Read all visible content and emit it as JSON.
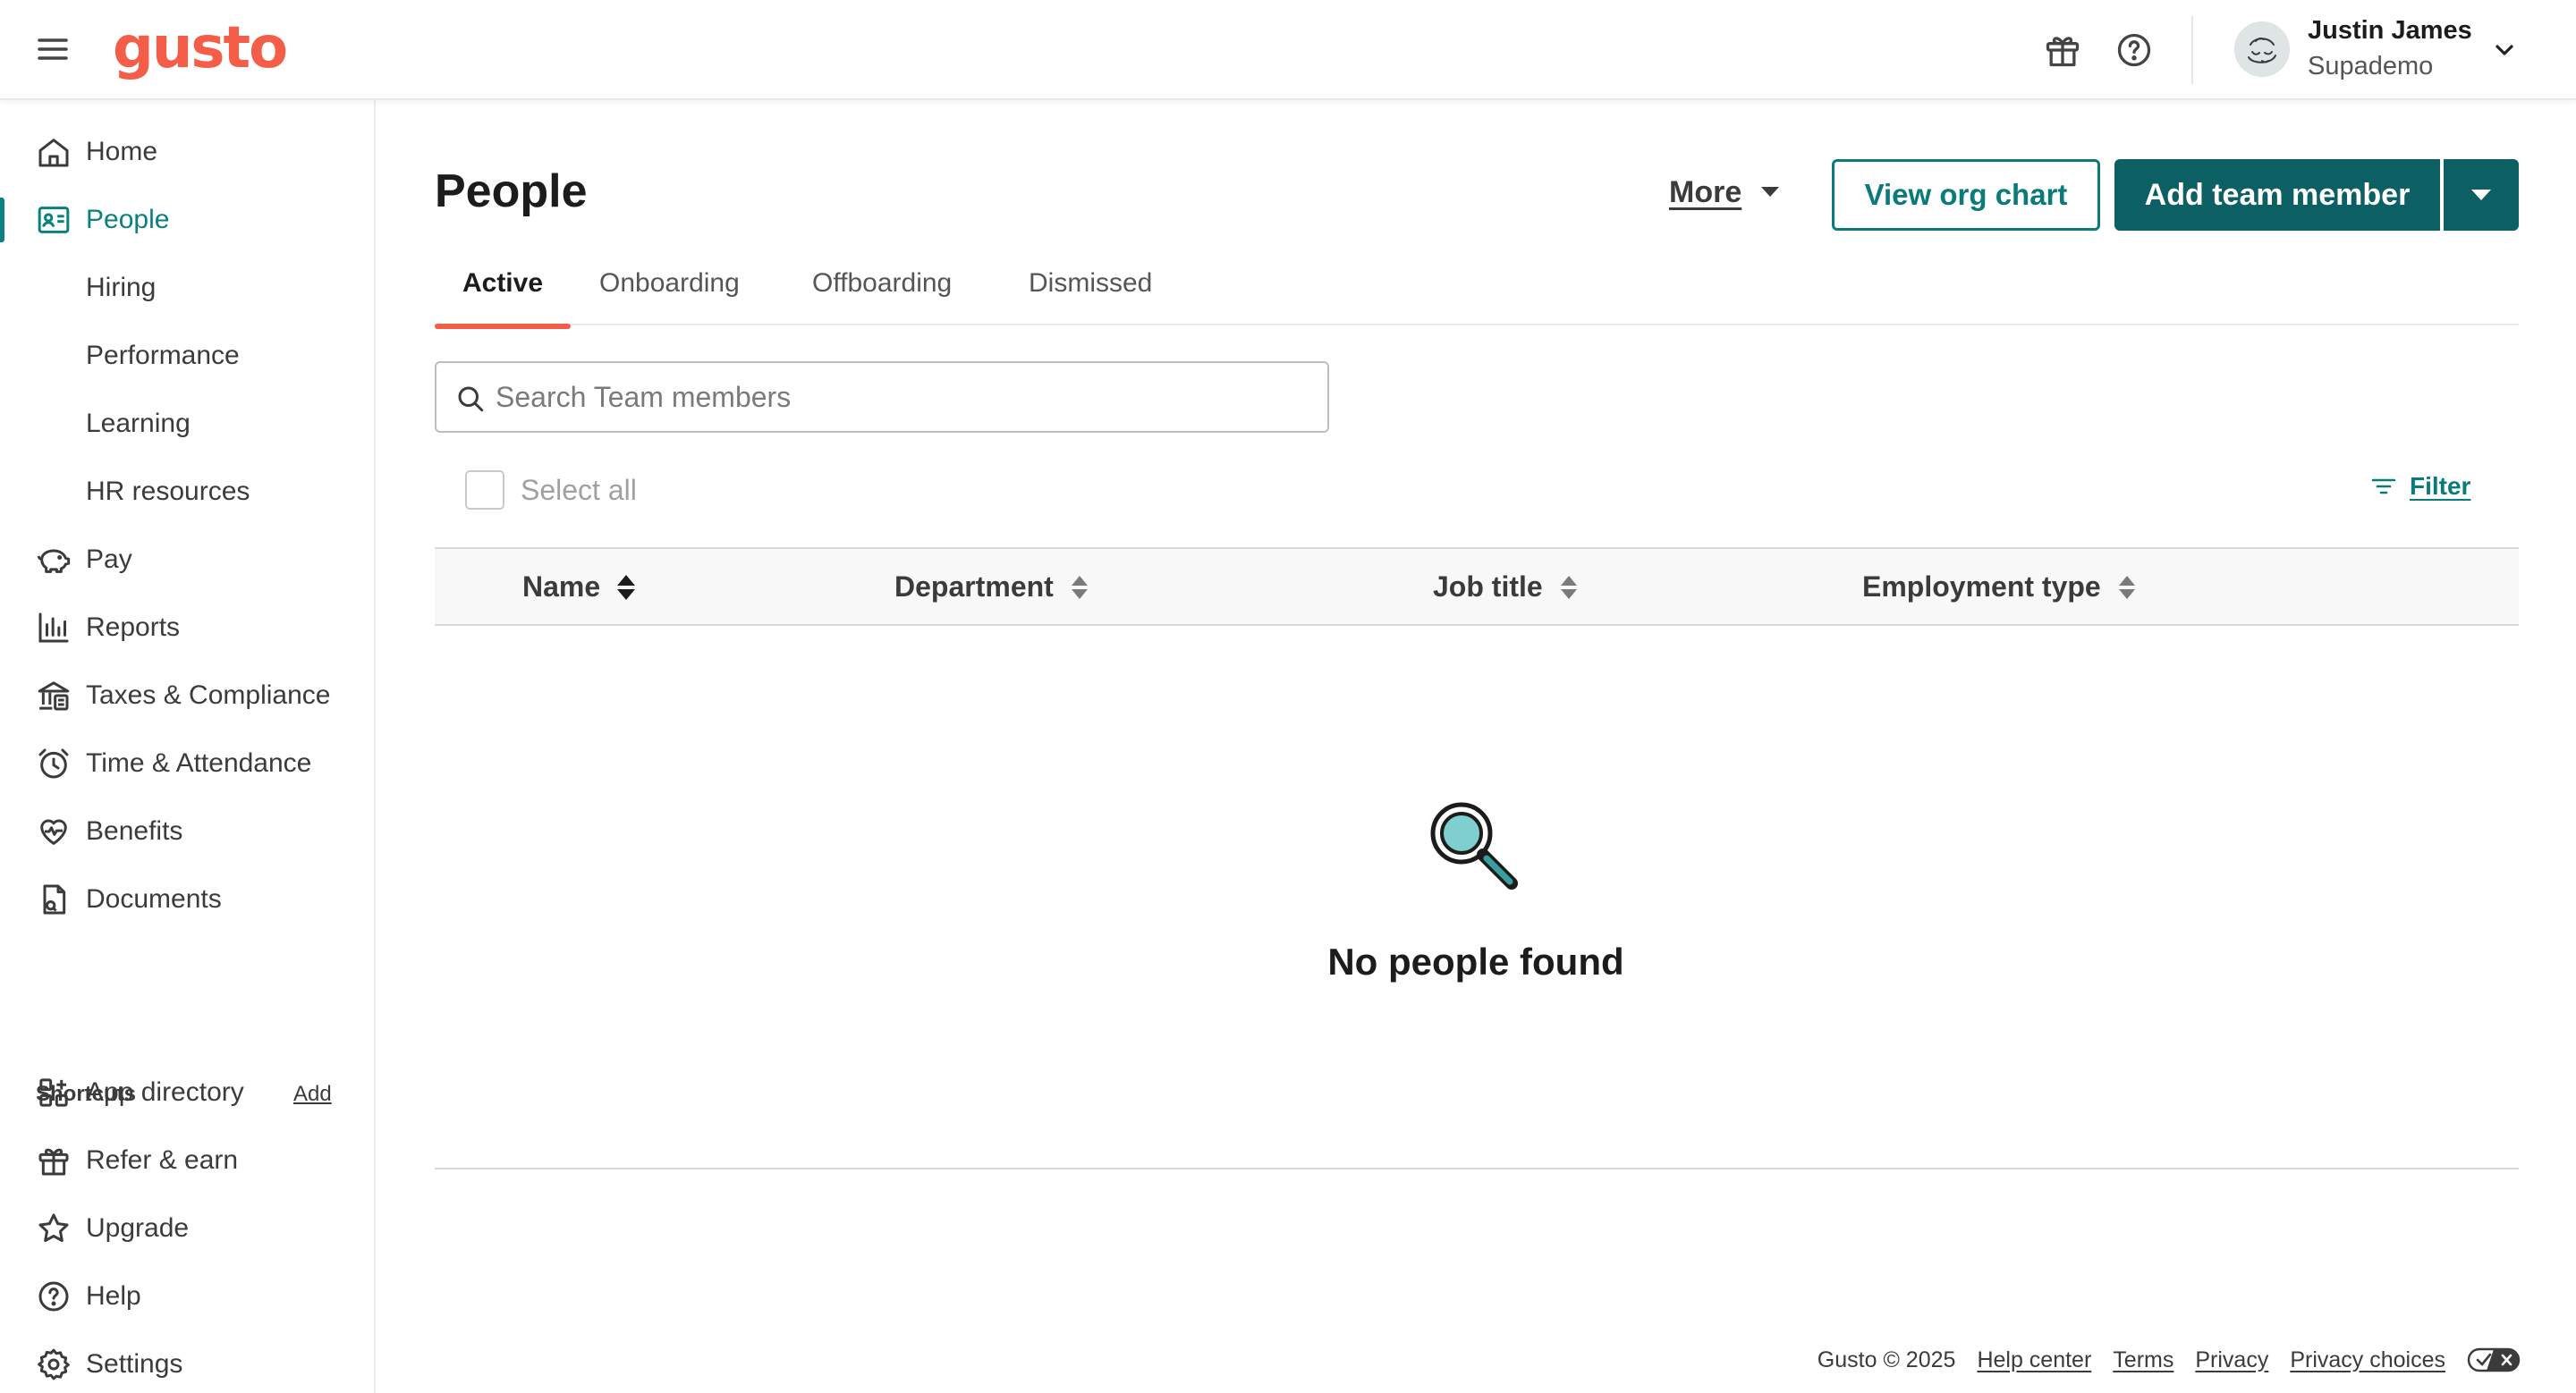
{
  "header": {
    "logo": "gusto",
    "user_name": "Justin James",
    "user_company": "Supademo",
    "icons": [
      "menu-icon",
      "gift-icon",
      "help-circle-icon",
      "chevron-down-icon"
    ]
  },
  "sidebar": {
    "items": [
      {
        "label": "Home",
        "icon": "home-icon"
      },
      {
        "label": "People",
        "icon": "person-card-icon",
        "active": true
      },
      {
        "label": "Hiring"
      },
      {
        "label": "Performance"
      },
      {
        "label": "Learning"
      },
      {
        "label": "HR resources"
      },
      {
        "label": "Pay",
        "icon": "piggy-bank-icon"
      },
      {
        "label": "Reports",
        "icon": "bar-chart-icon"
      },
      {
        "label": "Taxes & Compliance",
        "icon": "bank-icon"
      },
      {
        "label": "Time & Attendance",
        "icon": "alarm-clock-icon"
      },
      {
        "label": "Benefits",
        "icon": "heart-pulse-icon"
      },
      {
        "label": "Documents",
        "icon": "document-icon"
      }
    ],
    "shortcuts_label": "Shortcuts",
    "shortcuts_add": "Add",
    "bottom_items": [
      {
        "label": "App directory",
        "icon": "apps-grid-icon"
      },
      {
        "label": "Refer & earn",
        "icon": "gift-icon"
      },
      {
        "label": "Upgrade",
        "icon": "star-icon"
      },
      {
        "label": "Help",
        "icon": "help-circle-icon"
      },
      {
        "label": "Settings",
        "icon": "gear-icon"
      }
    ]
  },
  "main": {
    "title": "People",
    "more_label": "More",
    "view_org_chart_label": "View org chart",
    "add_team_member_label": "Add team member",
    "tabs": [
      {
        "label": "Active",
        "active": true
      },
      {
        "label": "Onboarding"
      },
      {
        "label": "Offboarding"
      },
      {
        "label": "Dismissed"
      }
    ],
    "search_placeholder": "Search Team members",
    "search_value": "",
    "select_all_label": "Select all",
    "filter_label": "Filter",
    "columns": [
      "Name",
      "Department",
      "Job title",
      "Employment type"
    ],
    "rows": [],
    "empty_message": "No people found"
  },
  "footer": {
    "copyright": "Gusto © 2025",
    "links": [
      "Help center",
      "Terms",
      "Privacy",
      "Privacy choices"
    ]
  },
  "colors": {
    "brand": "#f45d48",
    "accent": "#0a7a7a",
    "primary_button": "#0c5f63"
  }
}
